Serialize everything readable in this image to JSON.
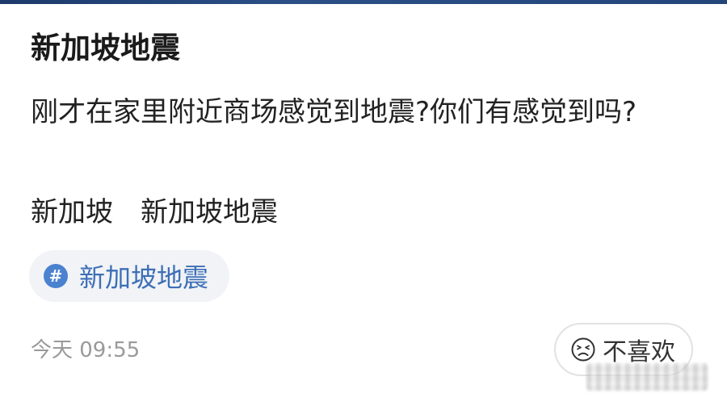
{
  "post": {
    "title": "新加坡地震",
    "body": "刚才在家里附近商场感觉到地震?你们有感觉到吗?",
    "tags": [
      "新加坡",
      "新加坡地震"
    ],
    "topic": {
      "icon": "hashtag-icon",
      "symbol": "#",
      "label": "新加坡地震"
    },
    "time": "今天 09:55",
    "dislike": {
      "icon": "frown-face-icon",
      "label": "不喜欢"
    }
  },
  "colors": {
    "topic_text": "#3d6fb6",
    "topic_badge": "#4b82d0",
    "time_text": "#9a9a9a",
    "top_strip": "#24457a"
  }
}
